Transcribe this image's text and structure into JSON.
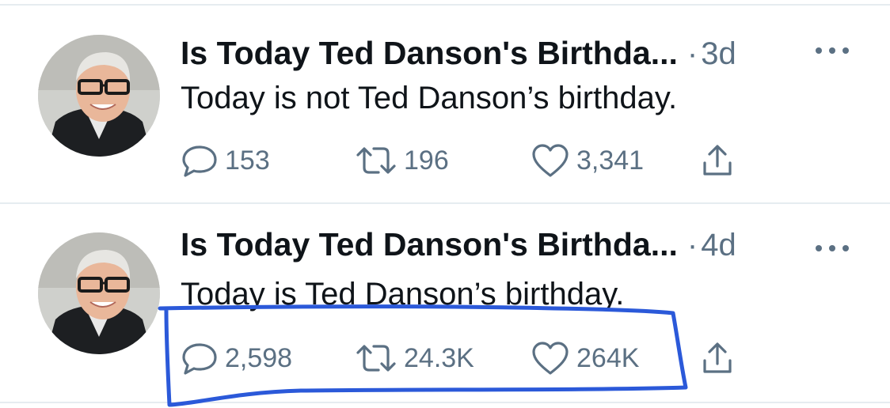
{
  "tweets": [
    {
      "author": "Is Today Ted Danson's Birthda...",
      "separator": "·",
      "time": "3d",
      "text": "Today is not Ted Danson’s birthday.",
      "replies": "153",
      "retweets": "196",
      "likes": "3,341"
    },
    {
      "author": "Is Today Ted Danson's Birthda...",
      "separator": "·",
      "time": "4d",
      "text": "Today is Ted Danson’s birthday.",
      "replies": "2,598",
      "retweets": "24.3K",
      "likes": "264K"
    }
  ],
  "icons": {
    "more": "more-horizontal-icon",
    "reply": "reply-icon",
    "retweet": "retweet-icon",
    "like": "heart-icon",
    "share": "share-icon"
  },
  "colors": {
    "text": "#0f1419",
    "secondary": "#5b7083",
    "divider": "#e6ecf0",
    "annotation": "#2b59d9"
  }
}
